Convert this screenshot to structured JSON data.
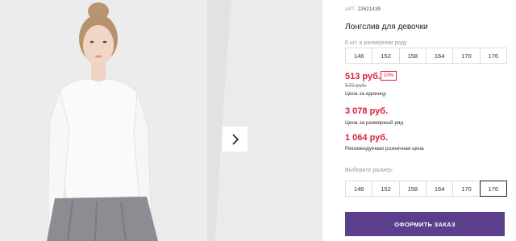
{
  "product": {
    "article_label": "АРТ:",
    "article_number": "22621439",
    "title": "Лонгслив для девочки",
    "pack_note": "6 шт. в размерном ряду",
    "sizes_top": [
      "146",
      "152",
      "158",
      "164",
      "170",
      "176"
    ],
    "price_unit": "513 руб.",
    "discount_badge": "10%",
    "price_old": "570 руб.",
    "price_unit_label": "Цена за единицу",
    "price_size_row": "3 078 руб.",
    "price_size_row_label": "Цена за размерный ряд",
    "price_retail": "1 064 руб.",
    "price_retail_label": "Рекомендуемая розничная цена",
    "choose_size_label": "Выберите размер:",
    "sizes_select": [
      "146",
      "152",
      "158",
      "164",
      "170",
      "176"
    ],
    "selected_size": "176",
    "order_button": "ОФОРМИТЬ ЗАКАЗ"
  },
  "colors": {
    "price_red": "#d8203a",
    "order_button_bg": "#5b3f8c"
  },
  "icons": {
    "gallery_next": "chevron-right-icon"
  }
}
